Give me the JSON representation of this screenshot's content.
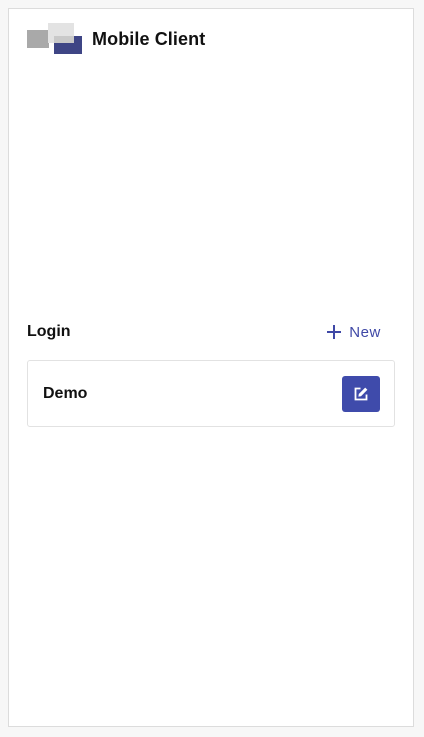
{
  "app": {
    "title": "Mobile Client"
  },
  "logins": {
    "section_title": "Login",
    "new_label": "New",
    "items": [
      {
        "label": "Demo"
      }
    ]
  },
  "colors": {
    "accent": "#3f4bab",
    "link": "#3f48a6",
    "logo_dark": "#3e4585"
  },
  "icons": {
    "new": "plus-icon",
    "edit": "edit-icon"
  }
}
